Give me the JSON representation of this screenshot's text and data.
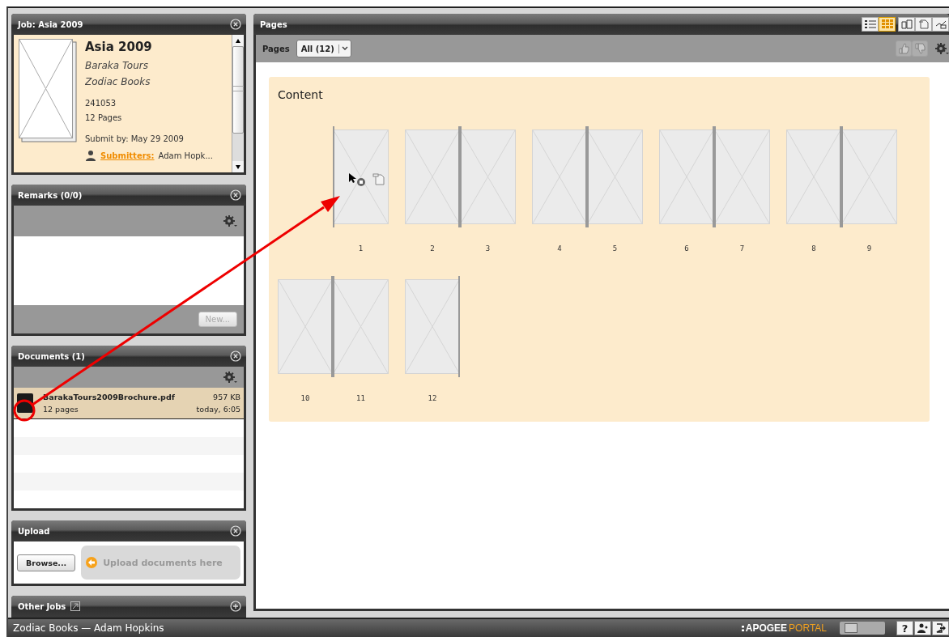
{
  "job_panel": {
    "title": "Job: Asia 2009",
    "name": "Asia 2009",
    "customer": "Baraka Tours",
    "publisher": "Zodiac Books",
    "job_number": "241053",
    "page_count": "12 Pages",
    "submit_by": "Submit by: May 29 2009",
    "submitters_label": "Submitters:",
    "submitters": "Adam Hopk..."
  },
  "remarks_panel": {
    "title": "Remarks (0/0)",
    "new_button": {
      "label": "New...",
      "disabled": true
    }
  },
  "documents_panel": {
    "title": "Documents (1)",
    "documents": [
      {
        "name": "BarakaTours2009Brochure.pdf",
        "size": "957 KB",
        "pages": "12 pages",
        "date": "today, 6:05",
        "selected": true
      }
    ]
  },
  "upload_panel": {
    "title": "Upload",
    "browse_button": "Browse...",
    "drop_zone": "Upload documents here"
  },
  "other_jobs_panel": {
    "title": "Other Jobs",
    "expanded": false
  },
  "pages_panel": {
    "title": "Pages",
    "view_buttons": [
      {
        "kind": "list",
        "selected": false
      },
      {
        "kind": "grid",
        "selected": true
      }
    ],
    "mode_buttons": [
      {
        "kind": "book"
      },
      {
        "kind": "page"
      },
      {
        "kind": "compare"
      }
    ],
    "filter_label": "Pages",
    "filter_value": "All (12)",
    "approval_disabled": true,
    "section_title": "Content",
    "spreads": [
      {
        "right_page": {
          "number": "1",
          "hovered": true
        }
      },
      {
        "left_page": {
          "number": "2",
          "hovered": false
        },
        "right_page": {
          "number": "3",
          "hovered": false
        }
      },
      {
        "left_page": {
          "number": "4",
          "hovered": false
        },
        "right_page": {
          "number": "5",
          "hovered": false
        }
      },
      {
        "left_page": {
          "number": "6",
          "hovered": false
        },
        "right_page": {
          "number": "7",
          "hovered": false
        }
      },
      {
        "left_page": {
          "number": "8",
          "hovered": false
        },
        "right_page": {
          "number": "9",
          "hovered": false
        }
      },
      {
        "left_page": {
          "number": "10",
          "hovered": false
        },
        "right_page": {
          "number": "11",
          "hovered": false
        }
      },
      {
        "left_page": {
          "number": "12",
          "hovered": false
        }
      }
    ]
  },
  "status_bar": {
    "text": "Zodiac Books — Adam Hopkins",
    "logo_primary": "APOGEE",
    "logo_accent": "PORTAL",
    "toggle": {
      "on": false
    },
    "help": "?"
  }
}
